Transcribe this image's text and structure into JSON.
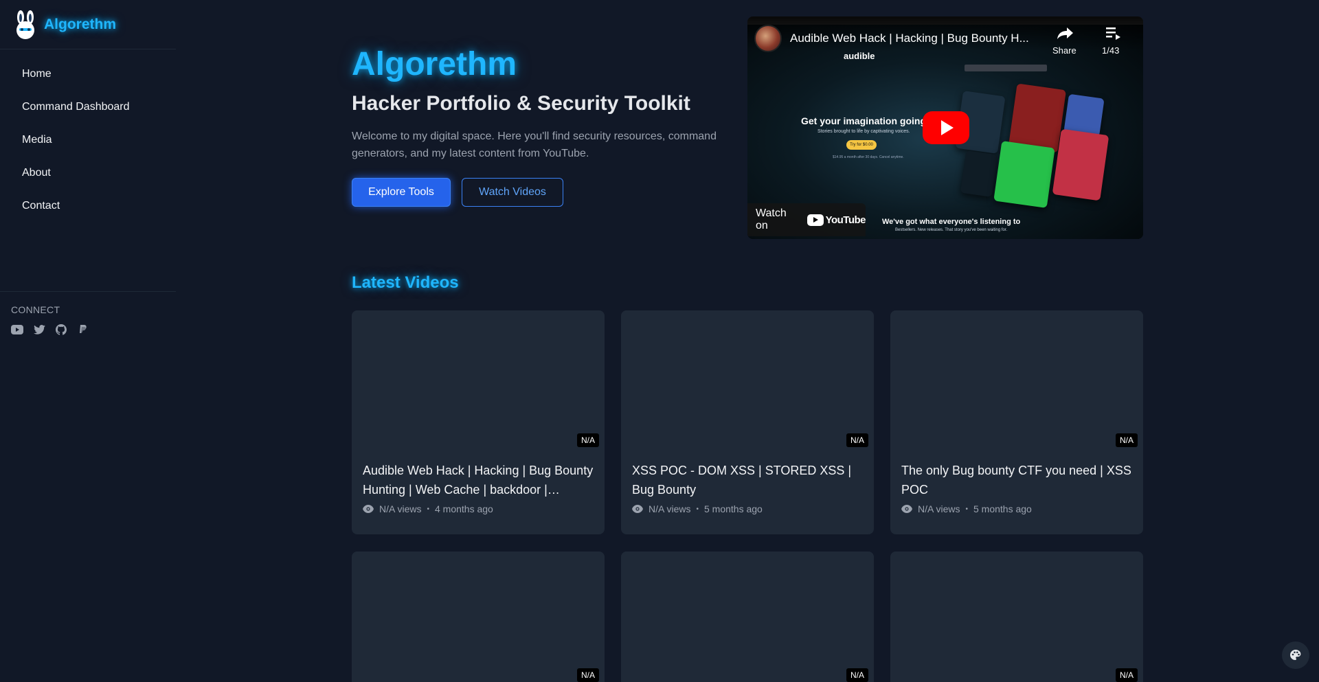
{
  "brand": {
    "name": "Algorethm"
  },
  "sidebar": {
    "items": [
      {
        "label": "Home"
      },
      {
        "label": "Command Dashboard"
      },
      {
        "label": "Media"
      },
      {
        "label": "About"
      },
      {
        "label": "Contact"
      }
    ],
    "connect_label": "CONNECT",
    "social_icons": [
      "youtube-icon",
      "twitter-icon",
      "github-icon",
      "paypal-icon"
    ]
  },
  "hero": {
    "title": "Algorethm",
    "subtitle": "Hacker Portfolio & Security Toolkit",
    "description": "Welcome to my digital space. Here you'll find security resources, command generators, and my latest content from YouTube.",
    "primary_button": "Explore Tools",
    "secondary_button": "Watch Videos"
  },
  "embed": {
    "title": "Audible Web Hack | Hacking | Bug Bounty H...",
    "share_label": "Share",
    "playlist_count": "1/43",
    "audible_logo": "audible",
    "promo_title": "Get your imagination going",
    "promo_line": "Stories brought to life by captivating voices.",
    "promo_button": "Try for $0.00",
    "promo_fine": "$14.95 a month after 30 days. Cancel anytime.",
    "watch_on": "Watch on",
    "youtube_word": "YouTube",
    "bottom_caption": "We've got what everyone's listening to",
    "bottom_caption2": "Bestsellers. New releases. That story you've been waiting for."
  },
  "latest": {
    "title": "Latest Videos",
    "videos": [
      {
        "title": "Audible Web Hack | Hacking | Bug Bounty Hunting | Web Cache | backdoor | Recon...",
        "duration": "N/A",
        "views": "N/A views",
        "age": "4 months ago"
      },
      {
        "title": "XSS POC - DOM XSS | STORED XSS | Bug Bounty",
        "duration": "N/A",
        "views": "N/A views",
        "age": "5 months ago"
      },
      {
        "title": "The only Bug bounty CTF you need | XSS POC",
        "duration": "N/A",
        "views": "N/A views",
        "age": "5 months ago"
      },
      {
        "title": "",
        "duration": "N/A",
        "views": "",
        "age": ""
      },
      {
        "title": "",
        "duration": "N/A",
        "views": "",
        "age": ""
      },
      {
        "title": "",
        "duration": "N/A",
        "views": "",
        "age": ""
      }
    ],
    "separator": "•"
  },
  "colors": {
    "accent": "#1fb6ff",
    "primary_button": "#2563eb",
    "background": "#111827",
    "card": "#1f2937"
  }
}
